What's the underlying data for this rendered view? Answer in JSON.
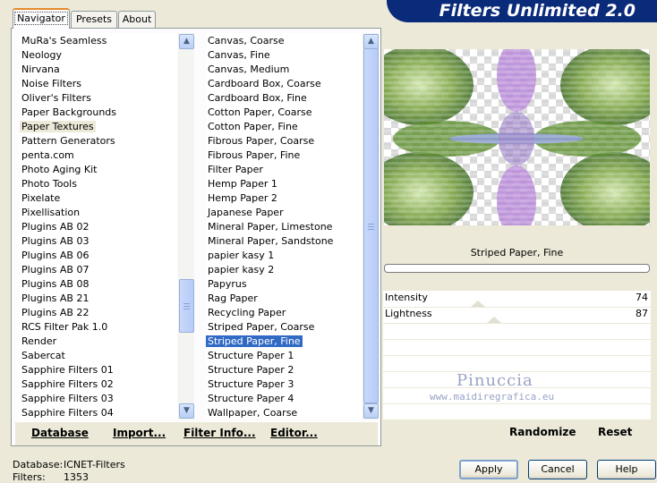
{
  "window": {
    "title": "Filters Unlimited 2.0"
  },
  "tabs": [
    "Navigator",
    "Presets",
    "About"
  ],
  "categories": {
    "items": [
      "MuRa's Seamless",
      "Neology",
      "Nirvana",
      "Noise Filters",
      "Oliver's Filters",
      "Paper Backgrounds",
      "Paper Textures",
      "Pattern Generators",
      "penta.com",
      "Photo Aging Kit",
      "Photo Tools",
      "Pixelate",
      "Pixellisation",
      "Plugins AB 02",
      "Plugins AB 03",
      "Plugins AB 06",
      "Plugins AB 07",
      "Plugins AB 08",
      "Plugins AB 21",
      "Plugins AB 22",
      "RCS Filter Pak 1.0",
      "Render",
      "Sabercat",
      "Sapphire Filters 01",
      "Sapphire Filters 02",
      "Sapphire Filters 03",
      "Sapphire Filters 04"
    ],
    "highlighted": "Paper Textures"
  },
  "filters": {
    "items": [
      "Canvas, Coarse",
      "Canvas, Fine",
      "Canvas, Medium",
      "Cardboard Box, Coarse",
      "Cardboard Box, Fine",
      "Cotton Paper, Coarse",
      "Cotton Paper, Fine",
      "Fibrous Paper, Coarse",
      "Fibrous Paper, Fine",
      "Filter Paper",
      "Hemp Paper 1",
      "Hemp Paper 2",
      "Japanese Paper",
      "Mineral Paper, Limestone",
      "Mineral Paper, Sandstone",
      "papier kasy 1",
      "papier kasy 2",
      "Papyrus",
      "Rag Paper",
      "Recycling Paper",
      "Striped Paper, Coarse",
      "Striped Paper, Fine",
      "Structure Paper 1",
      "Structure Paper 2",
      "Structure Paper 3",
      "Structure Paper 4",
      "Wallpaper, Coarse"
    ],
    "selected": "Striped Paper, Fine"
  },
  "actions": {
    "database": "Database",
    "import": "Import...",
    "filter_info": "Filter Info...",
    "editor": "Editor..."
  },
  "preview": {
    "filter_name": "Striped Paper, Fine",
    "watermark_name": "Pinuccia",
    "watermark_url": "www.maidiregrafica.eu"
  },
  "parameters": [
    {
      "label": "Intensity",
      "value": "74",
      "level": 0.74
    },
    {
      "label": "Lightness",
      "value": "87",
      "level": 0.87
    }
  ],
  "preview_actions": {
    "randomize": "Randomize",
    "reset": "Reset"
  },
  "status": {
    "database_label": "Database:",
    "database_value": "ICNET-Filters",
    "filters_label": "Filters:",
    "filters_value": "1353"
  },
  "buttons": {
    "apply": "Apply",
    "cancel": "Cancel",
    "help": "Help"
  },
  "colors": {
    "title_bg": "#0a2a7a",
    "selection": "#316ac5",
    "button_border": "#003c74"
  },
  "icons": [
    "scroll-up-icon",
    "scroll-down-icon"
  ]
}
